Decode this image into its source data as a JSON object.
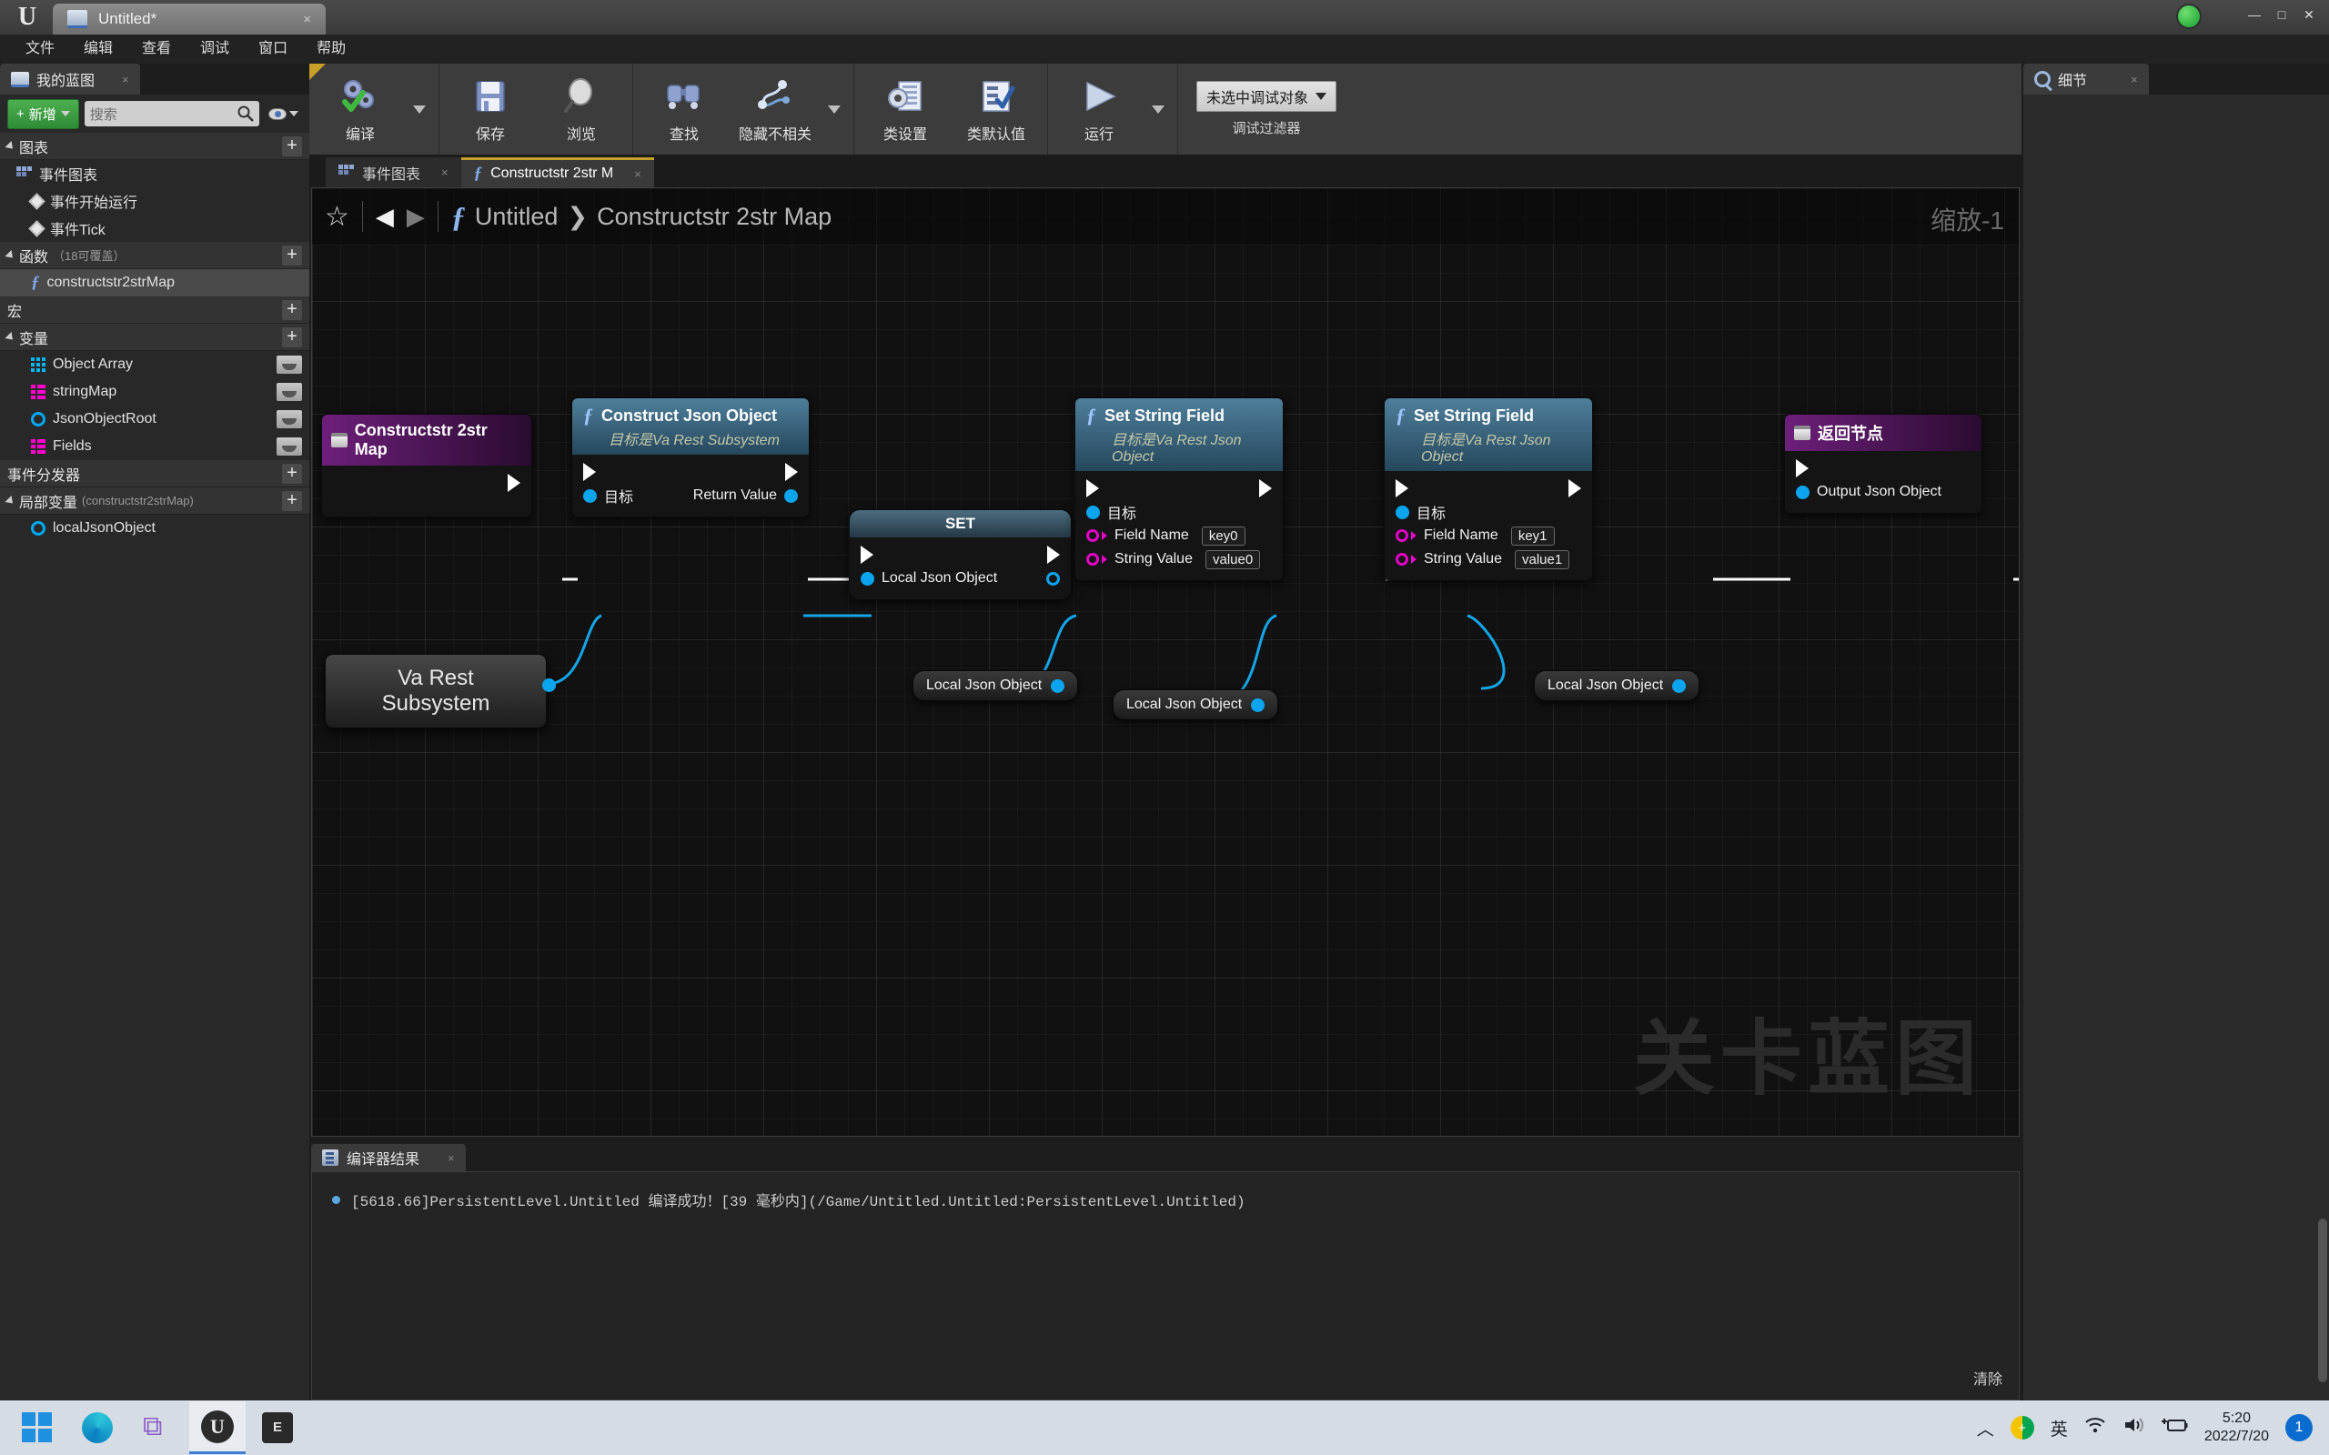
{
  "window": {
    "app_title": "Untitled*",
    "tab_close": "×",
    "minimize": "—",
    "maximize": "□",
    "close": "✕"
  },
  "menu": {
    "items": [
      {
        "label": "文件"
      },
      {
        "label": "编辑"
      },
      {
        "label": "查看"
      },
      {
        "label": "调试"
      },
      {
        "label": "窗口"
      },
      {
        "label": "帮助"
      }
    ]
  },
  "my_blueprint": {
    "tab_label": "我的蓝图",
    "tab_close": "×",
    "add_button": "新增",
    "add_plus": "+",
    "search_placeholder": "搜索",
    "sections": {
      "graphs": {
        "label": "图表",
        "plus": "+"
      },
      "functions": {
        "label": "函数",
        "count": "（18可覆盖）",
        "plus": "+"
      },
      "macros": {
        "label": "宏",
        "plus": "+"
      },
      "variables": {
        "label": "变量",
        "plus": "+"
      },
      "dispatchers": {
        "label": "事件分发器",
        "plus": "+"
      },
      "local_vars": {
        "label": "局部变量",
        "count": "(constructstr2strMap)",
        "plus": "+"
      }
    },
    "event_graph": {
      "label": "事件图表"
    },
    "events": [
      {
        "label": "事件开始运行"
      },
      {
        "label": "事件Tick"
      }
    ],
    "functions": [
      {
        "label": "constructstr2strMap"
      }
    ],
    "variables": [
      {
        "label": "Object Array",
        "kind": "array"
      },
      {
        "label": "stringMap",
        "kind": "map"
      },
      {
        "label": "JsonObjectRoot",
        "kind": "object"
      },
      {
        "label": "Fields",
        "kind": "map"
      }
    ],
    "local_variables": [
      {
        "label": "localJsonObject",
        "kind": "object"
      }
    ]
  },
  "toolbar": {
    "items": [
      {
        "label": "编译",
        "icon": "compile-icon",
        "has_caret": true
      },
      {
        "label": "保存",
        "icon": "save-icon",
        "has_caret": false
      },
      {
        "label": "浏览",
        "icon": "browse-icon",
        "has_caret": false
      },
      {
        "label": "查找",
        "icon": "find-icon",
        "has_caret": false
      },
      {
        "label": "隐藏不相关",
        "icon": "hide-unrelated-icon",
        "has_caret": true
      },
      {
        "label": "类设置",
        "icon": "class-settings-icon",
        "has_caret": false
      },
      {
        "label": "类默认值",
        "icon": "class-defaults-icon",
        "has_caret": false
      },
      {
        "label": "运行",
        "icon": "play-icon",
        "has_caret": true
      }
    ],
    "debug_object": "未选中调试对象",
    "debug_filter_label": "调试过滤器"
  },
  "graph_tabs": [
    {
      "label": "事件图表",
      "active": false,
      "close": "×"
    },
    {
      "label": "Constructstr 2str M",
      "active": true,
      "close": "×"
    }
  ],
  "graph": {
    "breadcrumb_root": "Untitled",
    "breadcrumb_separator": "❯",
    "breadcrumb_current": "Constructstr 2str Map",
    "zoom_label": "缩放-1",
    "watermark": "关卡蓝图",
    "nodes": {
      "entry": {
        "title": "Constructstr 2str Map"
      },
      "construct_json": {
        "title": "Construct Json Object",
        "subtitle": "目标是Va Rest Subsystem",
        "target_pin": "目标",
        "return_pin": "Return Value"
      },
      "set_node": {
        "title": "SET",
        "pin": "Local Json Object"
      },
      "set_string_field_0": {
        "title": "Set String Field",
        "subtitle": "目标是Va Rest Json Object",
        "target_pin": "目标",
        "field_name_label": "Field Name",
        "field_name_value": "key0",
        "string_value_label": "String Value",
        "string_value_value": "value0"
      },
      "set_string_field_1": {
        "title": "Set String Field",
        "subtitle": "目标是Va Rest Json Object",
        "target_pin": "目标",
        "field_name_label": "Field Name",
        "field_name_value": "key1",
        "string_value_label": "String Value",
        "string_value_value": "value1"
      },
      "return_node": {
        "title": "返回节点",
        "output_pin": "Output Json Object"
      },
      "subsystem_node": {
        "line1": "Va Rest",
        "line2": "Subsystem"
      },
      "local_json_1": {
        "label": "Local Json Object"
      },
      "local_json_2": {
        "label": "Local Json Object"
      },
      "local_json_3": {
        "label": "Local Json Object"
      }
    }
  },
  "details": {
    "tab_label": "细节",
    "tab_close": "×"
  },
  "compiler_results": {
    "tab_label": "编译器结果",
    "tab_close": "×",
    "message": "[5618.66]PersistentLevel.Untitled 编译成功！[39 毫秒内](/Game/Untitled.Untitled:PersistentLevel.Untitled)",
    "clear_label": "清除"
  },
  "taskbar": {
    "apps": [
      {
        "name": "start-button"
      },
      {
        "name": "edge"
      },
      {
        "name": "visual-studio"
      },
      {
        "name": "unreal-engine"
      },
      {
        "name": "epic-games"
      }
    ],
    "tray": {
      "chevron": "︿",
      "ime": "英",
      "time": "5:20",
      "date": "2022/7/20",
      "notification_count": "1"
    }
  },
  "colors": {
    "accent_green": "#2f8c36",
    "accent_blue": "#0aa5ee",
    "accent_magenta": "#e300c8",
    "purple_node": "#6d1f7a",
    "tab_highlight": "#c8a028"
  }
}
